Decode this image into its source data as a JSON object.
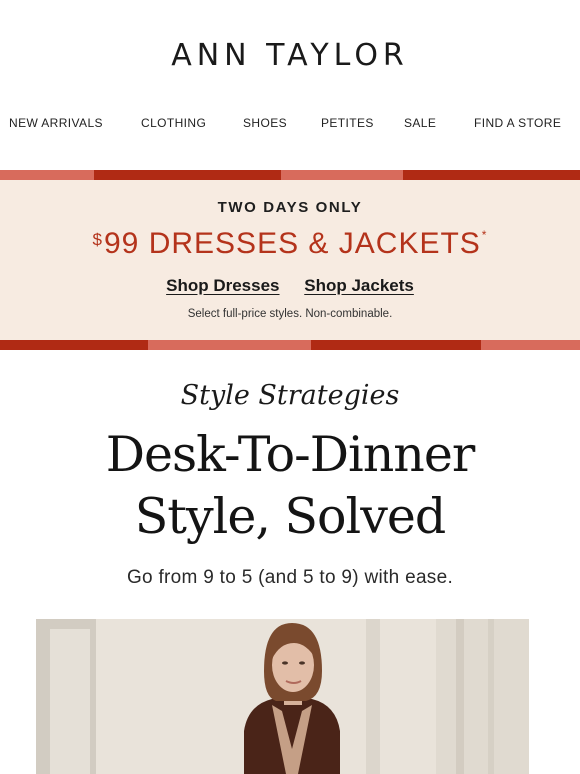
{
  "brand": {
    "logo_text": "ANN TAYLOR"
  },
  "nav": {
    "items": [
      "NEW ARRIVALS",
      "CLOTHING",
      "SHOES",
      "PETITES",
      "SALE",
      "FIND A STORE"
    ]
  },
  "promo": {
    "eyebrow": "TWO DAYS ONLY",
    "currency": "$",
    "headline": "99 DRESSES & JACKETS",
    "asterisk": "*",
    "link_dresses": "Shop Dresses",
    "link_jackets": "Shop Jackets",
    "fine_print": "Select full-price styles. Non-combinable.",
    "colors": {
      "accent": "#b4331b",
      "background": "#f7ebe1",
      "stripe_dark": "#b02a14",
      "stripe_light": "#d86b5c"
    }
  },
  "article": {
    "kicker": "Style Strategies",
    "title_line1": "Desk-To-Dinner",
    "title_line2": "Style, Solved",
    "subtitle": "Go from 9 to 5 (and 5 to 9) with ease."
  },
  "hero": {
    "image_description": "model-in-brown-blazer-photo"
  }
}
